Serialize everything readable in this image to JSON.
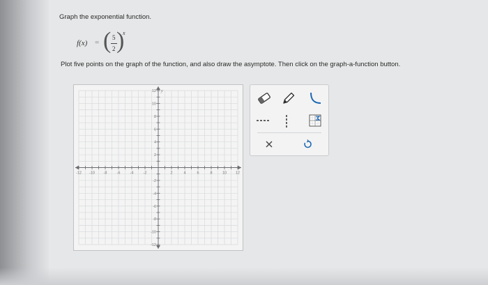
{
  "problem": {
    "title": "Graph the exponential function.",
    "function": {
      "lhs": "f(x)",
      "equals": "=",
      "numerator": "5",
      "denominator": "2",
      "exponent": "x"
    },
    "instructions": "Plot five points on the graph of the function, and also draw the asymptote. Then click on the graph-a-function button."
  },
  "graph": {
    "x_range": [
      -12,
      12
    ],
    "y_range": [
      -12,
      12
    ],
    "x_ticks": [
      "-12",
      "-10",
      "-8",
      "-6",
      "-4",
      "-2",
      "2",
      "4",
      "6",
      "8",
      "10",
      "12"
    ],
    "y_ticks": [
      "12",
      "10",
      "8",
      "6",
      "4",
      "2",
      "-2",
      "-4",
      "-6",
      "-8",
      "-10",
      "-12"
    ],
    "y_axis_label": "y",
    "grid": true
  },
  "toolbar": {
    "tools": [
      {
        "name": "eraser-icon"
      },
      {
        "name": "pencil-icon"
      },
      {
        "name": "curve-icon"
      },
      {
        "name": "dashed-line-icon"
      },
      {
        "name": "vertical-dashed-line-icon"
      },
      {
        "name": "graph-function-icon"
      },
      {
        "name": "close-icon"
      },
      {
        "name": "undo-icon"
      }
    ],
    "accent_color": "#1a66b3"
  }
}
